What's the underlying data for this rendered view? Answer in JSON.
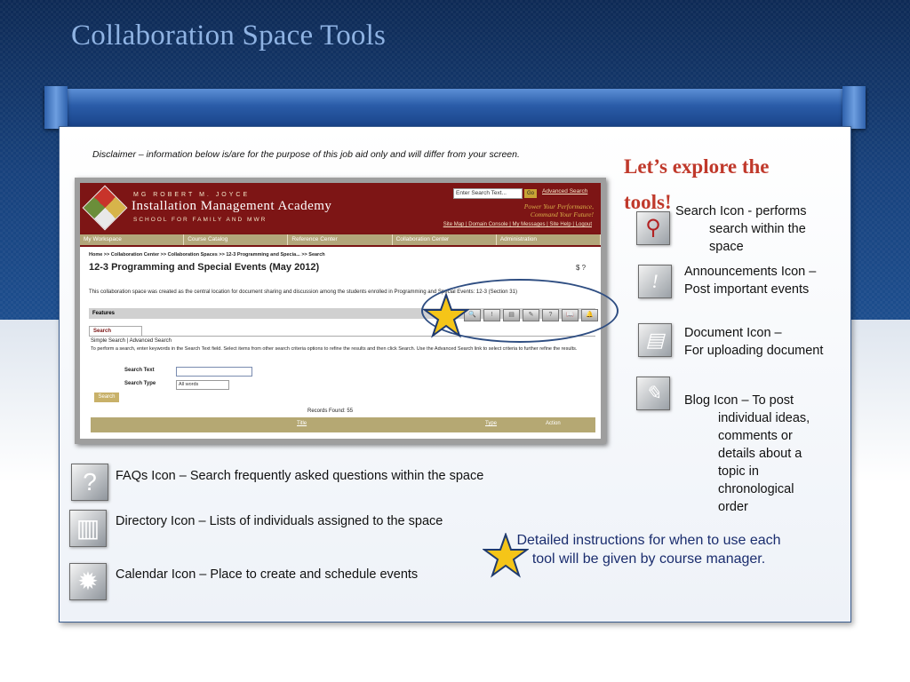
{
  "slide": {
    "title": "Collaboration Space Tools",
    "disclaimer": "Disclaimer – information below is/are for the purpose of this job aid only and will differ from your screen.",
    "explore": "Let’s explore the tools!",
    "details": "Detailed instructions for when to use each tool  will be given by course manager."
  },
  "screenshot": {
    "org_small": "MG ROBERT M. JOYCE",
    "org_name": "Installation Management Academy",
    "org_school": "SCHOOL FOR FAMILY AND MWR",
    "search_placeholder": "Enter Search Text...",
    "go_label": "Go",
    "advanced_search": "Advanced Search",
    "slogan_1": "Power Your Performance,",
    "slogan_2": "Command Your Future!",
    "top_links": "Site Map | Domain Console | My Messages | Site Help | Logout",
    "nav": [
      "My Workspace",
      "Course Catalog",
      "Reference Center",
      "Collaboration Center",
      "Administration"
    ],
    "breadcrumb": "Home >> Collaboration Center >> Collaboration Spaces >> 12-3 Programming and Specia... >> Search",
    "space_title": "12-3 Programming and Special Events (May 2012)",
    "space_icons": "$ ?",
    "description": "This collaboration space was created as the central location for document sharing and discussion among the students enrolled in Programming and Special Events: 12-3 (Section 31)",
    "features_label": "Features",
    "tool_glyphs": [
      "🔍",
      "!",
      "▤",
      "✎",
      "?",
      "📖",
      "🔔"
    ],
    "tab_search": "Search",
    "simple_search": "Simple Search | Advanced Search",
    "instructions": "To perform a search, enter keywords in the Search Text field. Select items from other search criteria options to refine the results and then click Search. Use the Advanced Search link to select criteria to further refine the results.",
    "search_text_label": "Search Text",
    "search_type_label": "Search Type",
    "search_type_value": "All words",
    "search_button": "Search",
    "records_found": "Records Found: 55",
    "col_title": "Title",
    "col_type": "Type",
    "col_action": "Action"
  },
  "tools_right": [
    {
      "icon": "search-icon",
      "glyph": "⚲",
      "line1": "Search Icon -  performs",
      "line2": "search within the",
      "line3": "space"
    },
    {
      "icon": "announcement-icon",
      "glyph": "!",
      "line1": "Announcements Icon –",
      "line2": "Post important events"
    },
    {
      "icon": "document-icon",
      "glyph": "▤",
      "line1": "Document Icon –",
      "line2": "For uploading document"
    },
    {
      "icon": "blog-icon",
      "glyph": "✎",
      "line1": "Blog Icon – To post",
      "lines": [
        "individual ideas,",
        "comments or",
        "details about a",
        "topic in",
        "chronological",
        "order"
      ]
    }
  ],
  "tools_bottom": [
    {
      "icon": "faq-icon",
      "glyph": "?",
      "text": "FAQs Icon – Search frequently asked questions within the space"
    },
    {
      "icon": "directory-icon",
      "glyph": "▥",
      "text": "Directory Icon – Lists of individuals assigned to the space"
    },
    {
      "icon": "calendar-icon",
      "glyph": "✹",
      "text": "Calendar Icon –  Place to create and schedule events"
    }
  ],
  "colors": {
    "accent_red": "#c0392b",
    "navy": "#1a2d6e",
    "star": "#f5c518"
  }
}
